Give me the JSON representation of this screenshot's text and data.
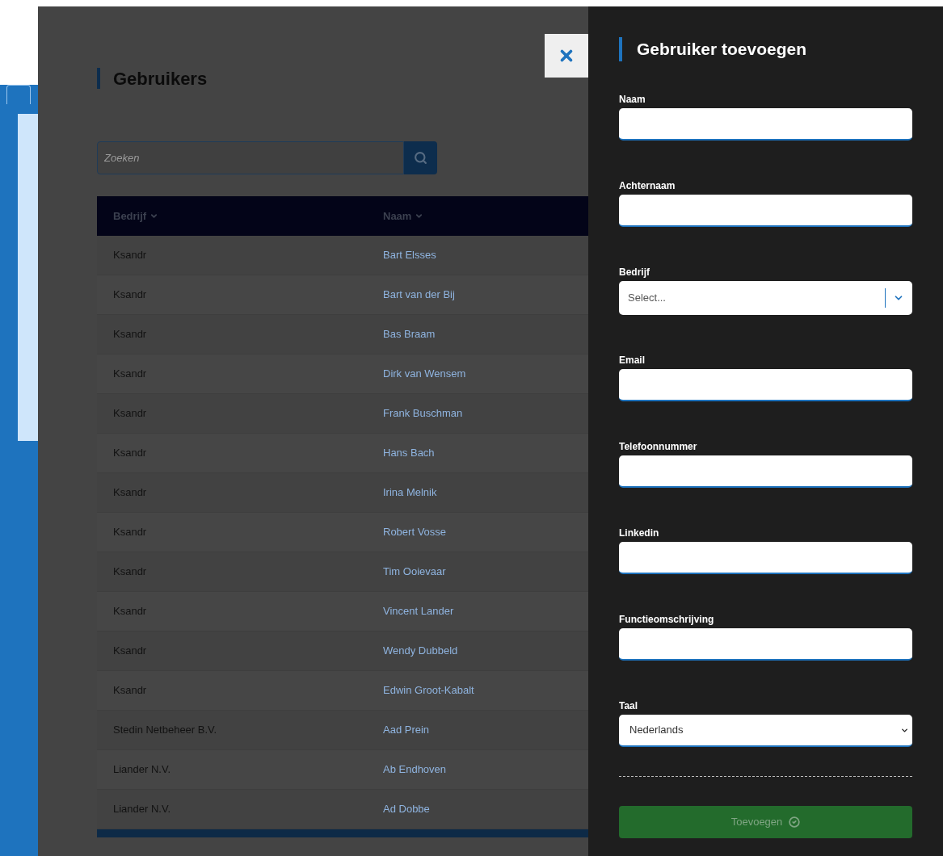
{
  "page": {
    "title": "Gebruikers",
    "search": {
      "placeholder": "Zoeken"
    },
    "table": {
      "columns": [
        {
          "label": "Bedrijf"
        },
        {
          "label": "Naam"
        }
      ],
      "rows": [
        {
          "company": "Ksandr",
          "name": "Bart Elsses"
        },
        {
          "company": "Ksandr",
          "name": "Bart van der Bij"
        },
        {
          "company": "Ksandr",
          "name": "Bas Braam"
        },
        {
          "company": "Ksandr",
          "name": "Dirk van Wensem"
        },
        {
          "company": "Ksandr",
          "name": "Frank Buschman"
        },
        {
          "company": "Ksandr",
          "name": "Hans Bach"
        },
        {
          "company": "Ksandr",
          "name": "Irina Melnik"
        },
        {
          "company": "Ksandr",
          "name": "Robert Vosse"
        },
        {
          "company": "Ksandr",
          "name": "Tim Ooievaar"
        },
        {
          "company": "Ksandr",
          "name": "Vincent Lander"
        },
        {
          "company": "Ksandr",
          "name": "Wendy Dubbeld"
        },
        {
          "company": "Ksandr",
          "name": "Edwin Groot-Kabalt"
        },
        {
          "company": "Stedin Netbeheer B.V.",
          "name": "Aad Prein"
        },
        {
          "company": "Liander N.V.",
          "name": "Ab Endhoven"
        },
        {
          "company": "Liander N.V.",
          "name": "Ad Dobbe"
        }
      ]
    }
  },
  "drawer": {
    "title": "Gebruiker toevoegen",
    "fields": [
      {
        "kind": "text",
        "label": "Naam"
      },
      {
        "kind": "text",
        "label": "Achternaam"
      },
      {
        "kind": "combobox",
        "label": "Bedrijf",
        "placeholder": "Select..."
      },
      {
        "kind": "text",
        "label": "Email"
      },
      {
        "kind": "text",
        "label": "Telefoonnummer"
      },
      {
        "kind": "text",
        "label": "Linkedin"
      },
      {
        "kind": "text",
        "label": "Functieomschrijving"
      },
      {
        "kind": "select",
        "label": "Taal",
        "value": "Nederlands"
      }
    ],
    "submit": {
      "label": "Toevoegen",
      "disabled": true
    }
  }
}
